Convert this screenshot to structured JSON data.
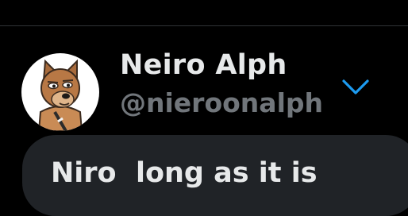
{
  "profile": {
    "display_name": "Neiro Alph",
    "handle": "@nieroonalph",
    "avatar_icon": "dog-avatar-icon"
  },
  "actions": {
    "more_icon": "chevron-down-icon",
    "accent_color": "#1d9bf0"
  },
  "message": {
    "text": "Niro  long as it is"
  },
  "colors": {
    "background": "#000000",
    "text_primary": "#e7e9ea",
    "text_secondary": "#71767b",
    "bubble": "#202327"
  }
}
